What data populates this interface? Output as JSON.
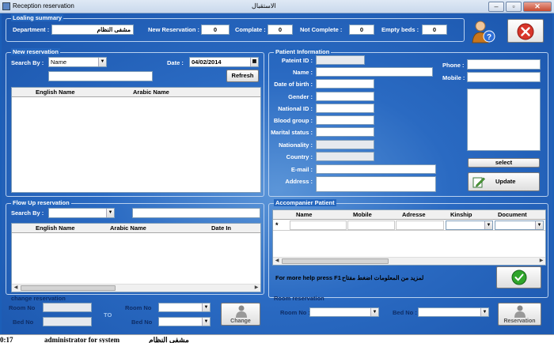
{
  "window": {
    "title": "Reception reservation",
    "title_ar": "الاستقبال"
  },
  "loading_summary": {
    "group_title": "Loaling summary",
    "department_label": "Department :",
    "department_value": "مشفى النظام",
    "new_reservation_label": "New Reservation :",
    "new_reservation_value": "0",
    "complete_label": "Complate :",
    "complete_value": "0",
    "not_complete_label": "Not  Complete :",
    "not_complete_value": "0",
    "empty_beds_label": "Empty beds :",
    "empty_beds_value": "0"
  },
  "new_reservation": {
    "group_title": "New reservation",
    "search_by_label": "Search By :",
    "search_by_value": "Name",
    "date_label": "Date :",
    "date_value": "04/02/2014",
    "refresh_label": "Refresh",
    "columns": [
      "English Name",
      "Arabic Name"
    ]
  },
  "patient_info": {
    "group_title": "Patient Information",
    "fields": {
      "patient_id": "Pateint ID :",
      "name": "Name :",
      "dob": "Date of birth :",
      "gender": "Gender :",
      "national_id": "National ID :",
      "blood_group": "Blood group :",
      "marital": "Marital status :",
      "nationality": "Nationality :",
      "country": "Country :",
      "email": "E-mail :",
      "address": "Address :",
      "phone": "Phone :",
      "mobile": "Mobile :"
    },
    "select_label": "select",
    "update_label": "Update"
  },
  "flow_up": {
    "group_title": "Flow Up reservation",
    "search_by_label": "Search By :",
    "columns": [
      "English Name",
      "Arabic Name",
      "Date In"
    ]
  },
  "accompanier": {
    "group_title": "Accompanier Patient",
    "columns": [
      "Name",
      "Mobile",
      "Adresse",
      "Kinship",
      "Document"
    ],
    "new_row_marker": "*",
    "help_text": "For more help press F1",
    "help_text_ar": "لمزيد من المعلومات اضغط مفتاح"
  },
  "change_reservation": {
    "group_title": "change reservation",
    "room_no_label": "Room No",
    "bed_no_label": "Bed No",
    "to_label": "TO",
    "room_no_label2": "Room No",
    "bed_no_label2": "Bed No",
    "change_label": "Change"
  },
  "room_reservation": {
    "group_title": "Room reservation",
    "room_no_label": "Room No :",
    "bed_no_label": "Bed No :",
    "reservation_label": "Reservation"
  },
  "status": {
    "time": "0:17",
    "user": "administrator for system",
    "dept": "مشفى النظام"
  },
  "colors": {
    "accent": "#1c5fb8",
    "label": "#ffffff",
    "close_red": "#d8352a",
    "ok_green": "#2fa52b"
  }
}
